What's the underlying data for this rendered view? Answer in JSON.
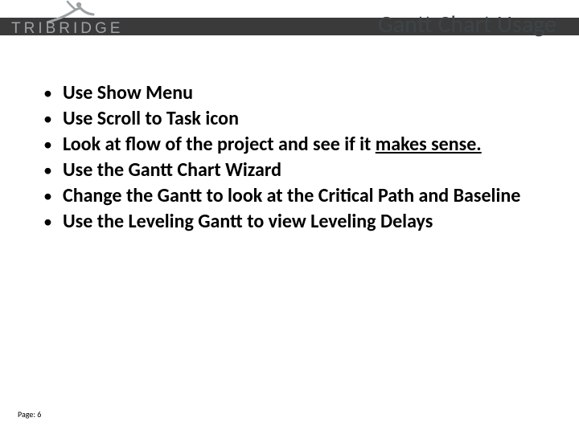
{
  "brand": {
    "name": "TRIBRIDGE"
  },
  "title": "Gantt Chart Usage",
  "bullets": {
    "b1": "Use Show Menu",
    "b2": "Use Scroll to Task icon",
    "b3_pre": "Look at flow of the project and see if it ",
    "b3_underline": "makes sense.",
    "b4": "Use the Gantt Chart Wizard",
    "b5": "Change the Gantt to look at the Critical Path and Baseline",
    "b6": "Use the Leveling Gantt to view Leveling Delays"
  },
  "footer": {
    "page_label": "Page: 6"
  }
}
